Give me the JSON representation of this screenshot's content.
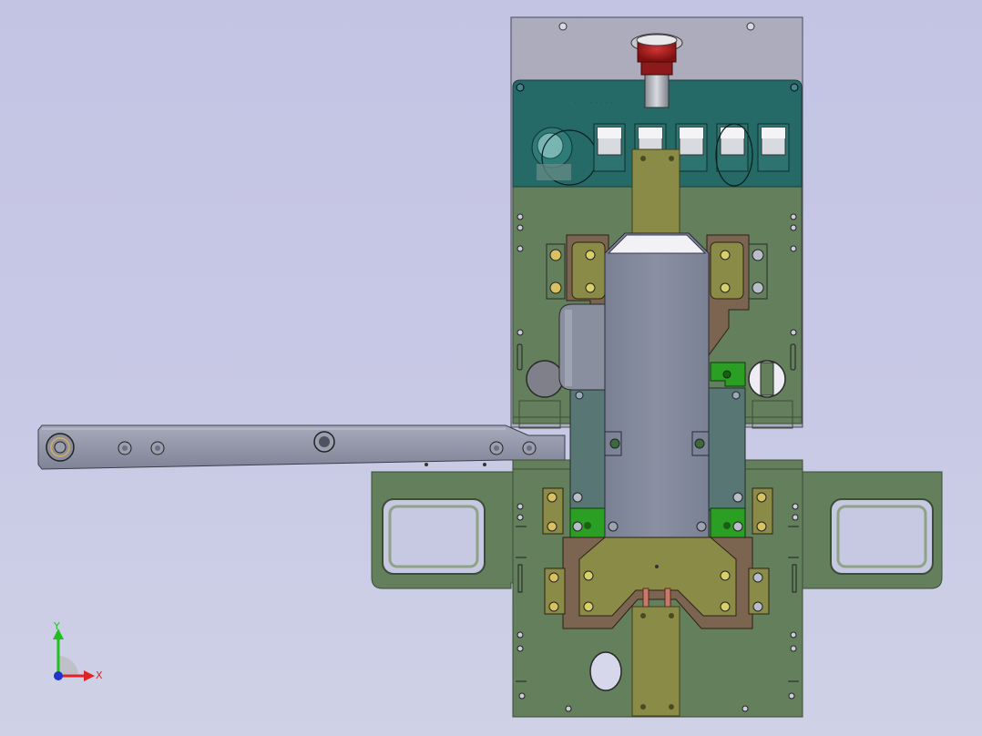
{
  "viewport": {
    "name": "3D model viewport",
    "background_top": "#c3c4e4",
    "background_bottom": "#cfd1e6"
  },
  "colors": {
    "plate_green": "#637f5c",
    "plate_edge": "#3b4d37",
    "panel_teal": "#256a67",
    "panel_top_gray": "#acacbc",
    "arm_steel": "#8f93a6",
    "block_gray": "#82889a",
    "block_teal": "#587674",
    "olive": "#8b8b48",
    "bronze": "#7b6450",
    "bright_green": "#2a9f24",
    "estop_red": "#a51f1f"
  },
  "triad": {
    "y_label": "Y",
    "x_label": "X",
    "y_color": "#1fbf1f",
    "x_color": "#e02323",
    "z_color": "#2233cc"
  }
}
